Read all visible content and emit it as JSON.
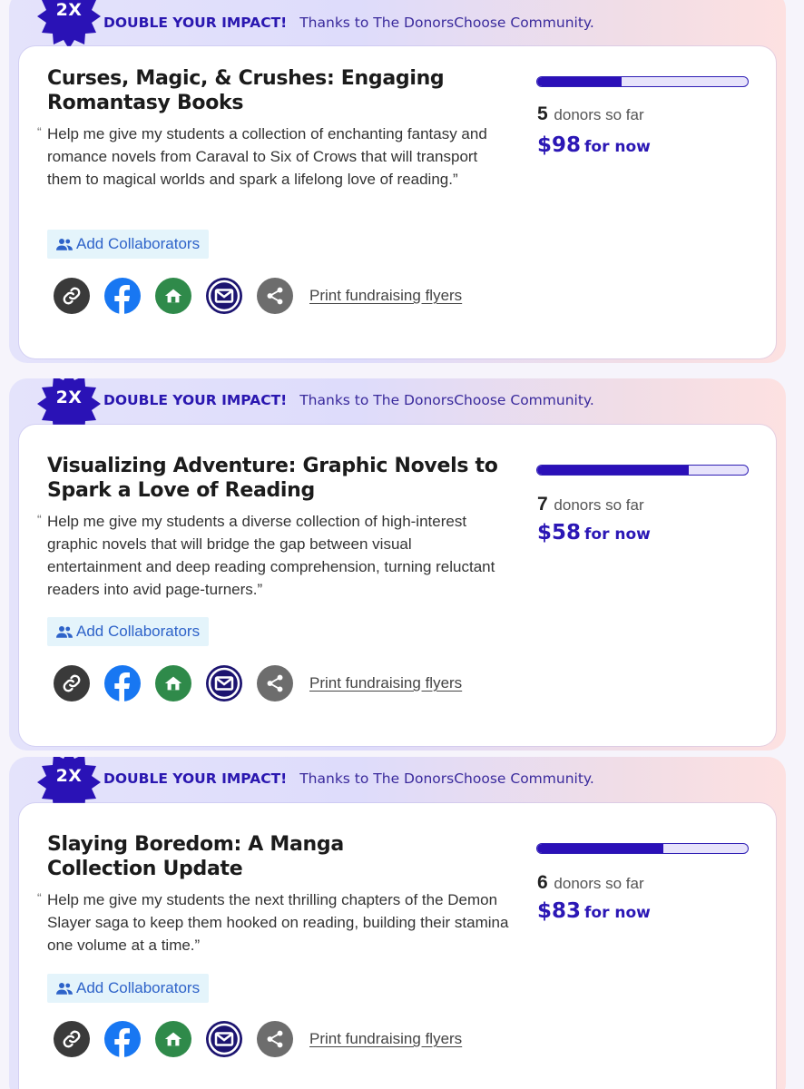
{
  "projects": [
    {
      "badge": "2X",
      "impact_label": "DOUBLE YOUR IMPACT!",
      "impact_thanks": "Thanks to The DonorsChoose Community.",
      "title": "Curses, Magic, & Crushes: Engaging Romantasy Books",
      "quote": "Help me give my students a collection of enchanting fantasy and romance novels from Caraval to Six of Crows that will transport them to magical worlds and spark a lifelong love of reading.”",
      "collab_label": "Add Collaborators",
      "print_label": "Print fundraising flyers",
      "progress_fraction": 0.4,
      "donor_count": "5",
      "donors_label": "donors so far",
      "amount": "$98",
      "amount_suffix": "for now"
    },
    {
      "badge": "2X",
      "impact_label": "DOUBLE YOUR IMPACT!",
      "impact_thanks": "Thanks to The DonorsChoose Community.",
      "title": "Visualizing Adventure: Graphic Novels to Spark a Love of Reading",
      "quote": "Help me give my students a diverse collection of high-interest graphic novels that will bridge the gap between visual entertainment and deep reading comprehension, turning reluctant readers into avid page-turners.”",
      "collab_label": "Add Collaborators",
      "print_label": "Print fundraising flyers",
      "progress_fraction": 0.72,
      "donor_count": "7",
      "donors_label": "donors so far",
      "amount": "$58",
      "amount_suffix": "for now"
    },
    {
      "badge": "2X",
      "impact_label": "DOUBLE YOUR IMPACT!",
      "impact_thanks": "Thanks to The DonorsChoose Community.",
      "title": "Slaying Boredom: A Manga Collection Update",
      "quote": "Help me give my students the next thrilling chapters of the Demon Slayer saga to keep them hooked on reading, building their stamina one volume at a time.”",
      "collab_label": "Add Collaborators",
      "print_label": "Print fundraising flyers",
      "progress_fraction": 0.6,
      "donor_count": "6",
      "donors_label": "donors so far",
      "amount": "$83",
      "amount_suffix": "for now"
    }
  ],
  "share_icons": [
    {
      "name": "link-icon",
      "color": "#3a3a3a"
    },
    {
      "name": "facebook-icon",
      "color": "#1877f2"
    },
    {
      "name": "home-icon",
      "color": "#2f8a4a"
    },
    {
      "name": "email-icon",
      "color": "#1c1470"
    },
    {
      "name": "share-icon",
      "color": "#6d6d6d"
    }
  ],
  "colors": {
    "brand": "#2b10b8",
    "collab_bg": "#e4f4fb",
    "collab_text": "#2e63c9"
  }
}
